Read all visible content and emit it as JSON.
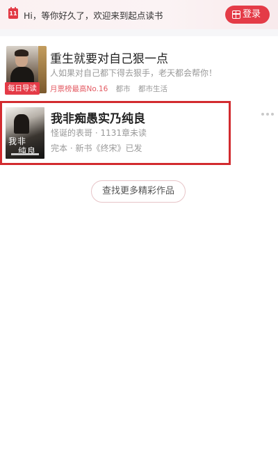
{
  "header": {
    "calendar_day": "11",
    "greeting": "Hi，等你好久了，欢迎来到起点读书",
    "login_label": "登录"
  },
  "books": [
    {
      "badge": "每日导读",
      "title": "重生就要对自己狠一点",
      "description": "人如果对自己都下得去狠手，老天都会帮你！",
      "rank": "月票榜最高No.16",
      "tags": [
        "都市",
        "都市生活"
      ]
    },
    {
      "cover_text_top": "我非",
      "cover_text_bottom": "纯良",
      "title": "我非痴愚实乃纯良",
      "author_line": "怪诞的表哥 · 1131章未读",
      "status_line": "完本 · 新书《终宋》已发"
    }
  ],
  "find_more_label": "查找更多精彩作品",
  "colors": {
    "accent": "#e43b47",
    "highlight_border": "#d22b2f"
  }
}
